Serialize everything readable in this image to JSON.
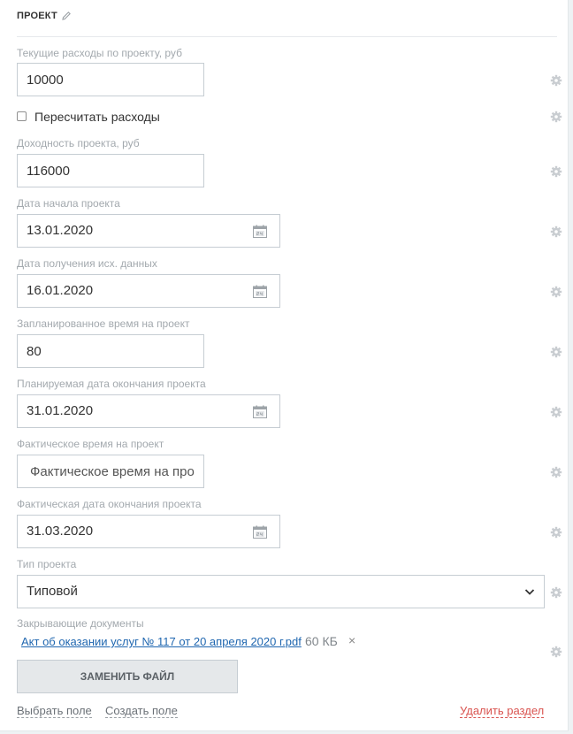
{
  "section": {
    "title": "ПРОЕКТ",
    "edit_icon": "pencil-icon"
  },
  "fields": {
    "current_costs": {
      "label": "Текущие расходы по проекту, руб",
      "value": "10000"
    },
    "recalculate": {
      "label": "Пересчитать расходы",
      "checked": false
    },
    "profitability": {
      "label": "Доходность проекта, руб",
      "value": "116000"
    },
    "start_date": {
      "label": "Дата начала проекта",
      "value": "13.01.2020"
    },
    "source_data_date": {
      "label": "Дата получения исх. данных",
      "value": "16.01.2020"
    },
    "planned_time": {
      "label": "Запланированное время на проект",
      "value": "80"
    },
    "planned_end_date": {
      "label": "Планируемая дата окончания проекта",
      "value": "31.01.2020"
    },
    "actual_time": {
      "label": "Фактическое время на проект",
      "value": "",
      "placeholder": "Фактическое время на проект"
    },
    "actual_end_date": {
      "label": "Фактическая дата окончания проекта",
      "value": "31.03.2020"
    },
    "project_type": {
      "label": "Тип проекта",
      "value": "Типовой"
    },
    "closing_docs": {
      "label": "Закрывающие документы",
      "file_name": "Акт об оказании услуг № 117 от 20 апреля 2020 г.pdf",
      "file_size": "60 КБ",
      "remove_symbol": "×",
      "replace_button": "ЗАМЕНИТЬ ФАЙЛ"
    }
  },
  "footer": {
    "select_field": "Выбрать поле",
    "create_field": "Создать поле",
    "delete_section": "Удалить раздел"
  },
  "icons": {
    "settings": "gear-icon",
    "calendar": "calendar-icon",
    "dropdown": "chevron-down-icon"
  },
  "colors": {
    "link": "#2067b0",
    "danger": "#d9534f",
    "label": "#a3a9ae",
    "border": "#c6cdd3"
  }
}
